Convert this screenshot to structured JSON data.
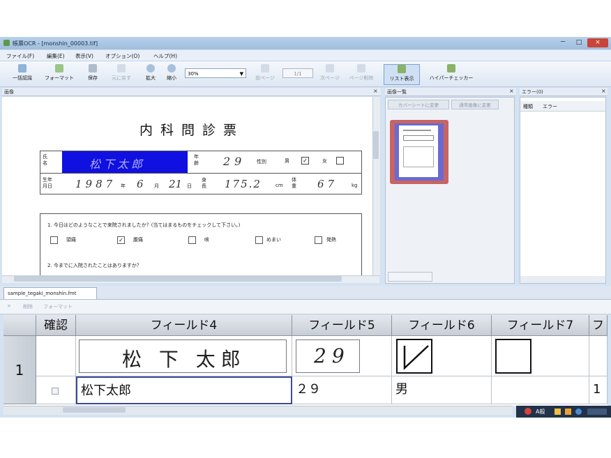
{
  "window": {
    "title": "帳票OCR - [monshin_00003.tif]",
    "controls": [
      "－",
      "□",
      "×"
    ]
  },
  "menu": [
    "ファイル(F)",
    "編集(E)",
    "表示(V)",
    "オプション(O)",
    "ヘルプ(H)"
  ],
  "toolbar": {
    "batch_recognize": "一括認識",
    "format": "フォーマット",
    "save": "保存",
    "undo": "元に戻す",
    "zoom_in": "拡大",
    "zoom_out": "縮小",
    "zoom_value": "30%",
    "prev_page": "前ページ",
    "page_counter": "1/1",
    "next_page": "次ページ",
    "delete_page": "ページ削除",
    "list_view": "リスト表示",
    "hyper_checker": "ハイパーチェッカー"
  },
  "panes": {
    "image_title": "画像",
    "list_title": "画像一覧",
    "error_title": "エラー(0)",
    "list_btn_cover": "カバーシートに変更",
    "list_btn_normal": "通常画像に変更",
    "error_col_item": "種類",
    "error_col_error": "エラー"
  },
  "document": {
    "title": "内科問診票",
    "name_label": "氏名",
    "name_value": "松下太郎",
    "age_label": "年齢",
    "age_value": "29",
    "sex_label": "性別",
    "male": "男",
    "female": "女",
    "birth_label": "生年月日",
    "birth_year": "1987",
    "year": "年",
    "birth_month": "6",
    "month": "月",
    "birth_day": "21",
    "day": "日",
    "height_label": "身長",
    "height_value": "175.2",
    "cm": "cm",
    "weight_label": "体重",
    "weight_value": "67",
    "kg": "kg",
    "q1": "1. 今日はどのようなことで来院されましたか？(当てはまるものをチェックして下さい。)",
    "q1_options": [
      "頭痛",
      "腹痛",
      "咳",
      "めまい",
      "発熱"
    ],
    "q2": "2. 今までに入院されたことはありますか？"
  },
  "tabs": {
    "active": "sample_tegaki_monshin.fmt"
  },
  "grid_toolbar": {
    "labels": [
      "×",
      "削除",
      "フォーマット"
    ]
  },
  "grid": {
    "headers": [
      "確認",
      "フィールド4",
      "フィールド5",
      "フィールド6",
      "フィールド7",
      "フ"
    ],
    "row_number": "1",
    "image_field4": "松 下 太郎",
    "image_field5": "29",
    "values": [
      "松下太郎",
      "２９",
      "男",
      "",
      "1"
    ]
  },
  "taskbar": {
    "tray_text": "A般"
  },
  "colors": {
    "selection_blue": "#1010e0",
    "thumb_border": "#c86464"
  }
}
